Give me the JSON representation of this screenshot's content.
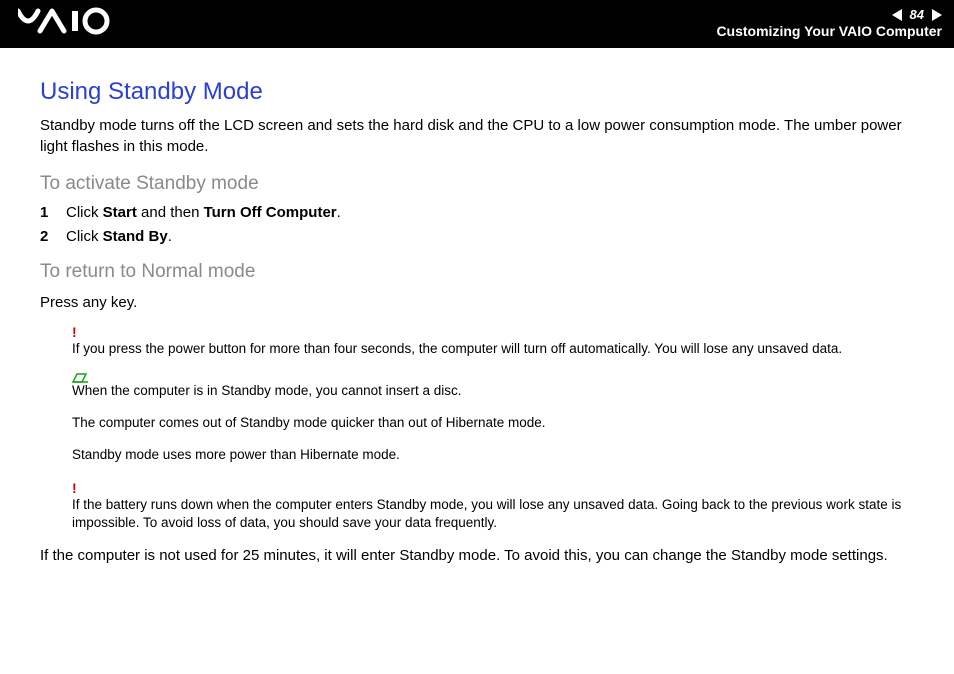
{
  "header": {
    "logo_text": "VAIO",
    "page_number": "84",
    "section": "Customizing Your VAIO Computer"
  },
  "title": "Using Standby Mode",
  "intro": "Standby mode turns off the LCD screen and sets the hard disk and the CPU to a low power consumption mode. The umber power light flashes in this mode.",
  "activate_heading": "To activate Standby mode",
  "steps": [
    {
      "num": "1",
      "pre": "Click ",
      "b1": "Start",
      "mid": " and then ",
      "b2": "Turn Off Computer",
      "post": "."
    },
    {
      "num": "2",
      "pre": "Click ",
      "b1": "Stand By",
      "mid": "",
      "b2": "",
      "post": "."
    }
  ],
  "return_heading": "To return to Normal mode",
  "return_body": "Press any key.",
  "warn1": "If you press the power button for more than four seconds, the computer will turn off automatically. You will lose any unsaved data.",
  "note1": "When the computer is in Standby mode, you cannot insert a disc.",
  "note2": "The computer comes out of Standby mode quicker than out of Hibernate mode.",
  "note3": "Standby mode uses more power than Hibernate mode.",
  "warn2": "If the battery runs down when the computer enters Standby mode, you will lose any unsaved data. Going back to the previous work state is impossible. To avoid loss of data, you should save your data frequently.",
  "footer_paragraph": "If the computer is not used for 25 minutes, it will enter Standby mode. To avoid this, you can change the Standby mode settings."
}
